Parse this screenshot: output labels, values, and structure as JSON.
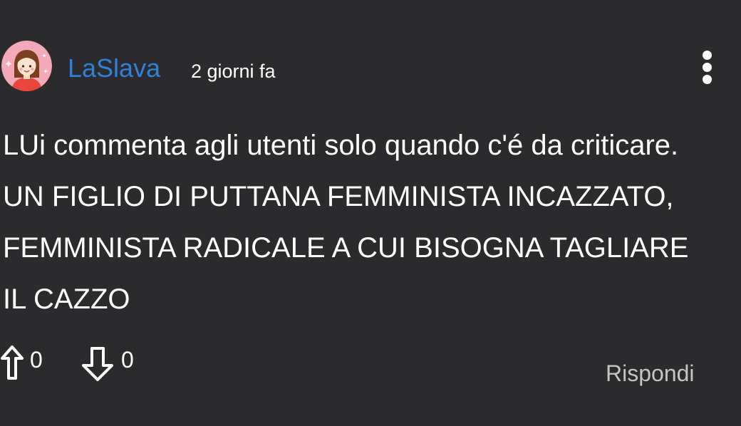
{
  "comment": {
    "author": "LaSlava",
    "timestamp": "2 giorni fa",
    "text": "LUi commenta agli utenti solo quando c'é da criticare. UN FIGLIO DI PUTTANA FEMMINISTA INCAZZATO, FEMMINISTA RADICALE A CUI BISOGNA TAGLIARE IL CAZZO",
    "upvotes": "0",
    "downvotes": "0",
    "reply_label": "Rispondi"
  },
  "icons": {
    "avatar": "girl-avatar-icon",
    "more": "more-vertical-icon",
    "upvote": "arrow-up-icon",
    "downvote": "arrow-down-icon"
  },
  "colors": {
    "background": "#2b2b2d",
    "username": "#2f80d8",
    "text": "#ffffff",
    "reply": "#c4c4c4",
    "avatar_bg": "#f4a9b8"
  }
}
